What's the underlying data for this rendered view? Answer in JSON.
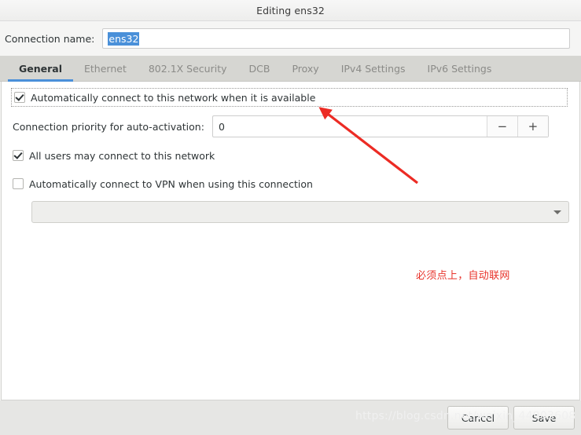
{
  "window": {
    "title": "Editing ens32"
  },
  "connection_name": {
    "label": "Connection name:",
    "value": "ens32",
    "placeholder": ""
  },
  "tabs": [
    {
      "label": "General",
      "active": true
    },
    {
      "label": "Ethernet",
      "active": false
    },
    {
      "label": "802.1X Security",
      "active": false
    },
    {
      "label": "DCB",
      "active": false
    },
    {
      "label": "Proxy",
      "active": false
    },
    {
      "label": "IPv4 Settings",
      "active": false
    },
    {
      "label": "IPv6 Settings",
      "active": false
    }
  ],
  "general": {
    "auto_connect": {
      "label": "Automatically connect to this network when it is available",
      "checked": true
    },
    "priority": {
      "label": "Connection priority for auto-activation:",
      "value": "0",
      "decrement_label": "−",
      "increment_label": "+"
    },
    "all_users": {
      "label": "All users may connect to this network",
      "checked": true
    },
    "auto_vpn": {
      "label": "Automatically connect to VPN when using this connection",
      "checked": false
    },
    "vpn_combo": {
      "value": "",
      "arrow_icon": "chevron-down-icon"
    }
  },
  "annotation": {
    "text": "必须点上，自动联网",
    "color": "#e8322a"
  },
  "actions": {
    "cancel_label": "Cancel",
    "save_label": "Save"
  },
  "watermark": {
    "text": "https://blog.csdn.net/weixin_44903608"
  },
  "colors": {
    "accent": "#4a90d9",
    "tabbar_bg": "#d6d6d2",
    "page_bg": "#ffffff",
    "annotation_red": "#e8322a",
    "selection_blue": "#4a90d9"
  }
}
